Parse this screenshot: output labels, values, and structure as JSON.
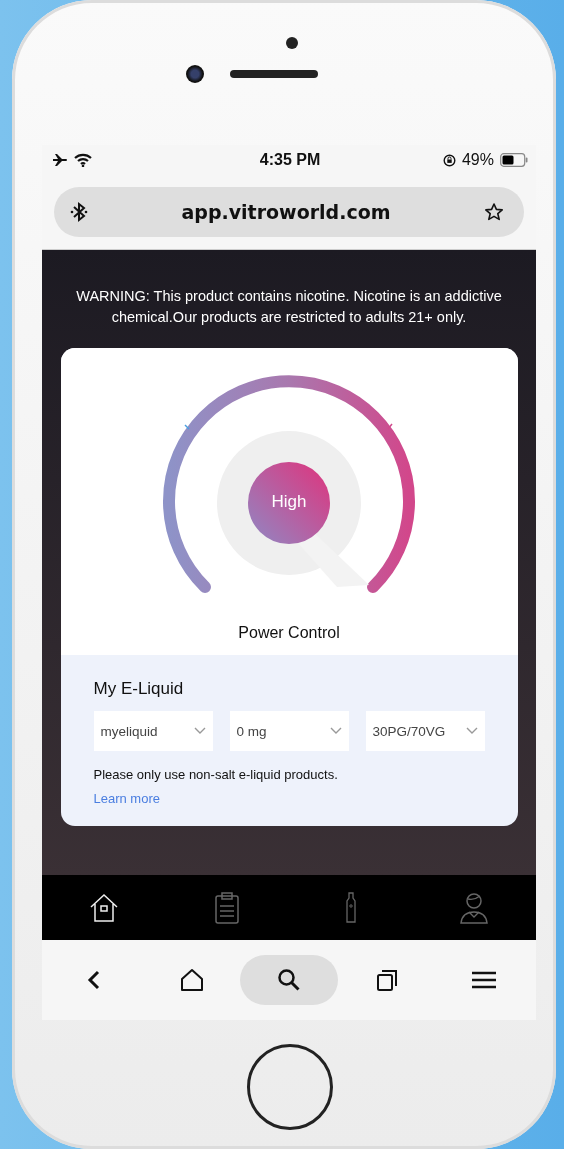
{
  "status_bar": {
    "time": "4:35 PM",
    "battery": "49%"
  },
  "address_bar": {
    "url": "app.vitroworld.com"
  },
  "warning": "WARNING: This product contains nicotine. Nicotine is an addictive chemical.Our products are restricted to adults 21+ only.",
  "power_control": {
    "mode": "High",
    "label": "Power Control"
  },
  "e_liquid": {
    "title": "My E-Liquid",
    "dropdowns": [
      {
        "value": "myeliquid"
      },
      {
        "value": "0 mg"
      },
      {
        "value": "30PG/70VG"
      }
    ],
    "note": "Please only use non-salt e-liquid products.",
    "link": "Learn more"
  },
  "app_tabs": [
    {
      "kind": "home",
      "selected": true
    },
    {
      "kind": "clipboard",
      "selected": false
    },
    {
      "kind": "device",
      "selected": false
    },
    {
      "kind": "profile",
      "selected": false
    }
  ],
  "browser_toolbar": [
    {
      "kind": "back",
      "selected": false
    },
    {
      "kind": "home",
      "selected": false
    },
    {
      "kind": "search",
      "selected": true
    },
    {
      "kind": "tabs",
      "selected": false
    },
    {
      "kind": "menu",
      "selected": false
    }
  ]
}
